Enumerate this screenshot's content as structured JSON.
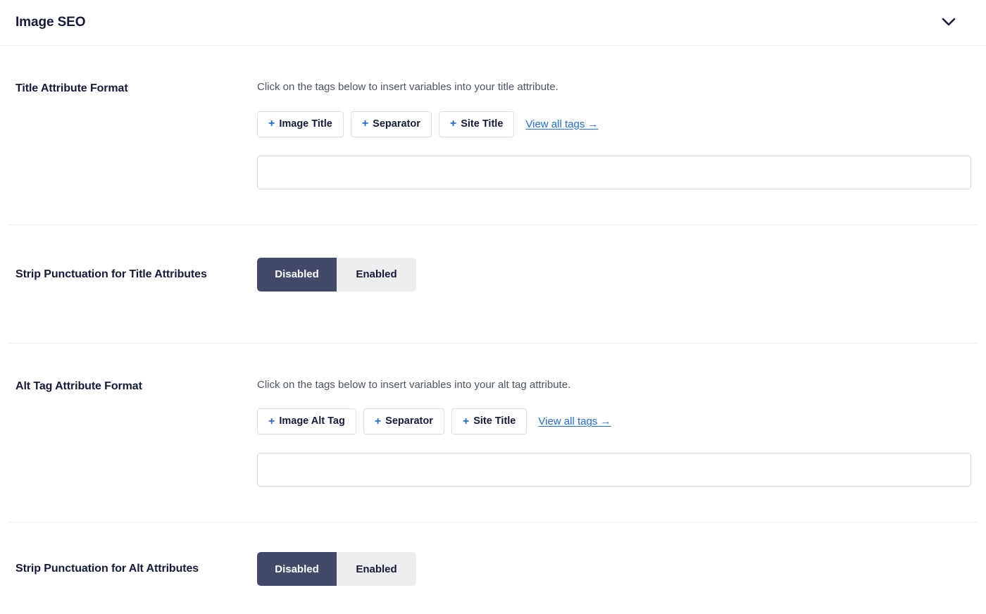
{
  "header": {
    "title": "Image SEO",
    "collapse_icon": "chevron-down-icon"
  },
  "rows": [
    {
      "id": "title-attribute-format",
      "label": "Title Attribute Format",
      "description": "Click on the tags below to insert variables into your title attribute.",
      "tags": [
        {
          "plus": "+",
          "label": "Image Title"
        },
        {
          "plus": "+",
          "label": "Separator"
        },
        {
          "plus": "+",
          "label": "Site Title"
        }
      ],
      "view_all_label": "View all tags →",
      "input_value": "",
      "input_placeholder": ""
    },
    {
      "id": "strip-punctuation-title",
      "label": "Strip Punctuation for Title Attributes",
      "options": [
        "Disabled",
        "Enabled"
      ],
      "selected": "Disabled"
    },
    {
      "id": "alt-tag-attribute-format",
      "label": "Alt Tag Attribute Format",
      "description": "Click on the tags below to insert variables into your alt tag attribute.",
      "tags": [
        {
          "plus": "+",
          "label": "Image Alt Tag"
        },
        {
          "plus": "+",
          "label": "Separator"
        },
        {
          "plus": "+",
          "label": "Site Title"
        }
      ],
      "view_all_label": "View all tags →",
      "input_value": "",
      "input_placeholder": ""
    },
    {
      "id": "strip-punctuation-alt",
      "label": "Strip Punctuation for Alt Attributes",
      "options": [
        "Disabled",
        "Enabled"
      ],
      "selected": "Disabled"
    }
  ],
  "colors": {
    "heading": "#141b38",
    "link": "#206bdb",
    "toggle_active_bg": "#434a67",
    "toggle_inactive_bg": "#eceef0",
    "border": "#dcdfe4",
    "divider": "#eceef0"
  }
}
